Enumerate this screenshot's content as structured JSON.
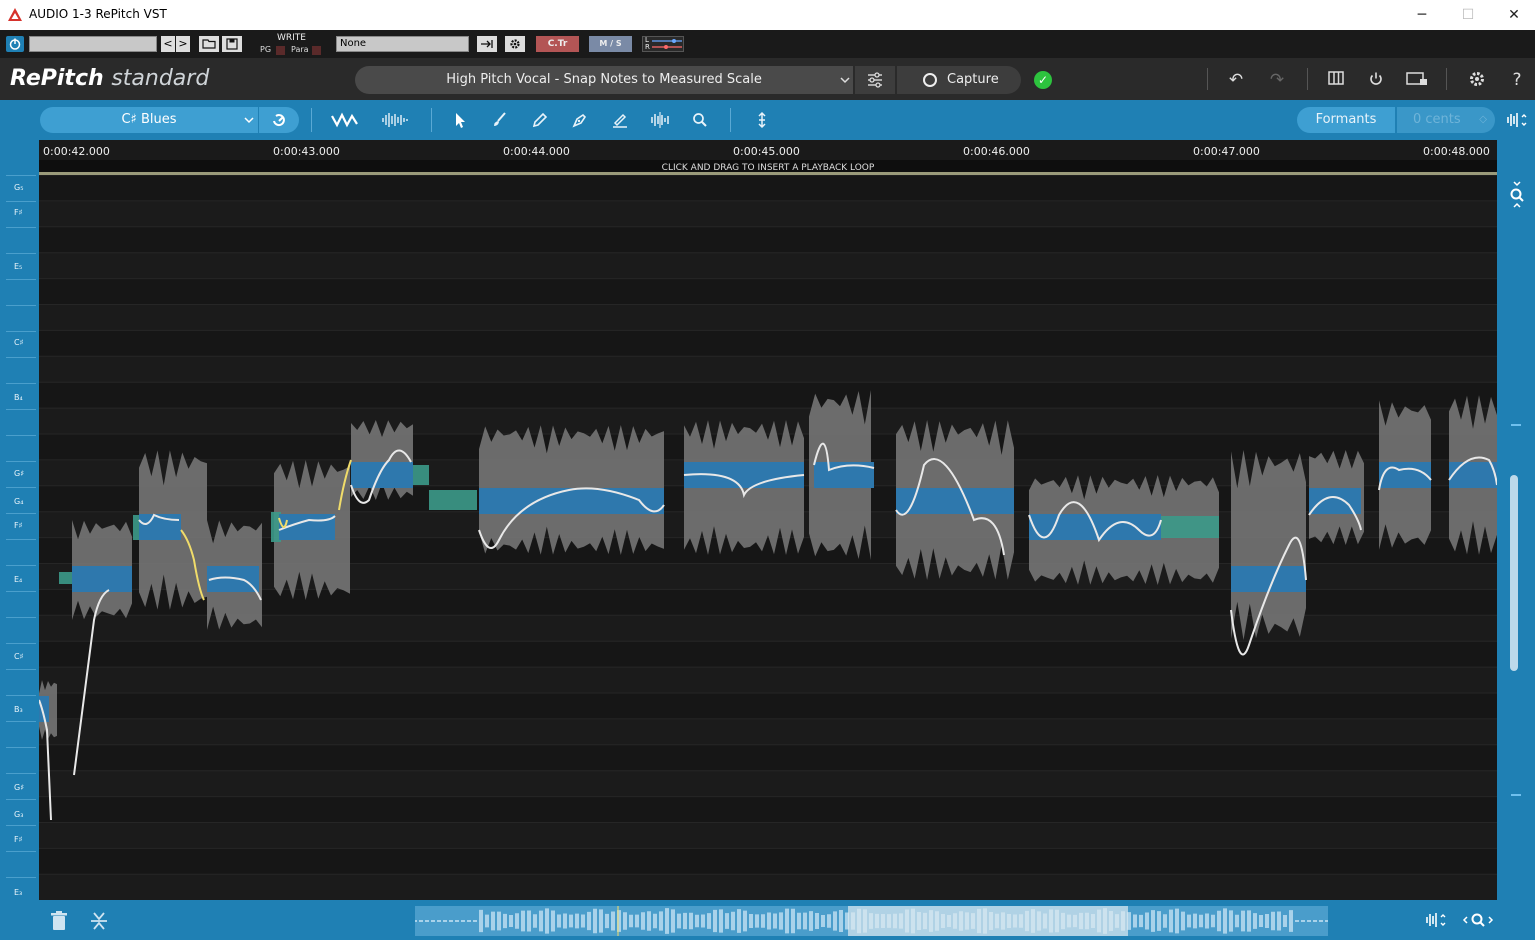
{
  "window": {
    "title": "AUDIO 1-3 RePitch VST",
    "minimize": "─",
    "maximize": "☐",
    "close": "✕"
  },
  "host_bar": {
    "write_label": "WRITE",
    "pg_label": "PG",
    "para_label": "Para",
    "preset_value": "None",
    "ctr_label": "C.Tr",
    "ms_label": "M / S",
    "lr_l": "L",
    "lr_r": "R"
  },
  "header": {
    "logo_main": "RePitch",
    "logo_edition": "standard",
    "preset": "High Pitch Vocal - Snap Notes to Measured Scale",
    "capture_label": "Capture"
  },
  "toolbar": {
    "scale": "C♯  Blues",
    "formants": "Formants",
    "cents": "0 cents"
  },
  "timeline": {
    "labels": [
      "0:00:42.000",
      "0:00:43.000",
      "0:00:44.000",
      "0:00:45.000",
      "0:00:46.000",
      "0:00:47.000",
      "0:00:48.000"
    ],
    "loop_hint": "CLICK AND DRAG TO INSERT A PLAYBACK LOOP"
  },
  "keyboard": {
    "notes": [
      "G₅",
      "F♯",
      "E₅",
      "C♯",
      "B₄",
      "G♯",
      "G₄",
      "F♯",
      "E₄",
      "C♯",
      "B₃",
      "G♯",
      "G₃",
      "F♯",
      "E₃"
    ]
  },
  "colors": {
    "accent": "#1f80b4",
    "note_blob": "#2e78ad",
    "waveform": "#7a7a7a",
    "pitch_curve": "#e8e8e8",
    "drift_curve": "#f0dc6a",
    "unvoiced": "#3c9a8a",
    "ok": "#2dc33e"
  }
}
